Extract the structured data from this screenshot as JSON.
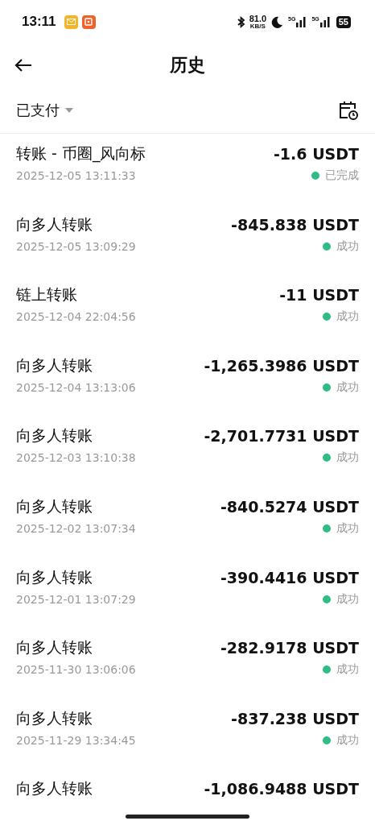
{
  "status_bar": {
    "time": "13:11",
    "net_speed": "81.0",
    "net_unit": "KB/S",
    "signal_1": "5G",
    "signal_2": "5G",
    "battery": "55"
  },
  "header": {
    "title": "历史"
  },
  "filter": {
    "label": "已支付"
  },
  "transactions": [
    {
      "title": "转账 - 币圈_风向标",
      "amount": "-1.6 USDT",
      "time": "2025-12-05 13:11:33",
      "status": "已完成"
    },
    {
      "title": "向多人转账",
      "amount": "-845.838 USDT",
      "time": "2025-12-05 13:09:29",
      "status": "成功"
    },
    {
      "title": "链上转账",
      "amount": "-11 USDT",
      "time": "2025-12-04 22:04:56",
      "status": "成功"
    },
    {
      "title": "向多人转账",
      "amount": "-1,265.3986 USDT",
      "time": "2025-12-04 13:13:06",
      "status": "成功"
    },
    {
      "title": "向多人转账",
      "amount": "-2,701.7731 USDT",
      "time": "2025-12-03 13:10:38",
      "status": "成功"
    },
    {
      "title": "向多人转账",
      "amount": "-840.5274 USDT",
      "time": "2025-12-02 13:07:34",
      "status": "成功"
    },
    {
      "title": "向多人转账",
      "amount": "-390.4416 USDT",
      "time": "2025-12-01 13:07:29",
      "status": "成功"
    },
    {
      "title": "向多人转账",
      "amount": "-282.9178 USDT",
      "time": "2025-11-30 13:06:06",
      "status": "成功"
    },
    {
      "title": "向多人转账",
      "amount": "-837.238 USDT",
      "time": "2025-11-29 13:34:45",
      "status": "成功"
    },
    {
      "title": "向多人转账",
      "amount": "-1,086.9488 USDT"
    }
  ]
}
